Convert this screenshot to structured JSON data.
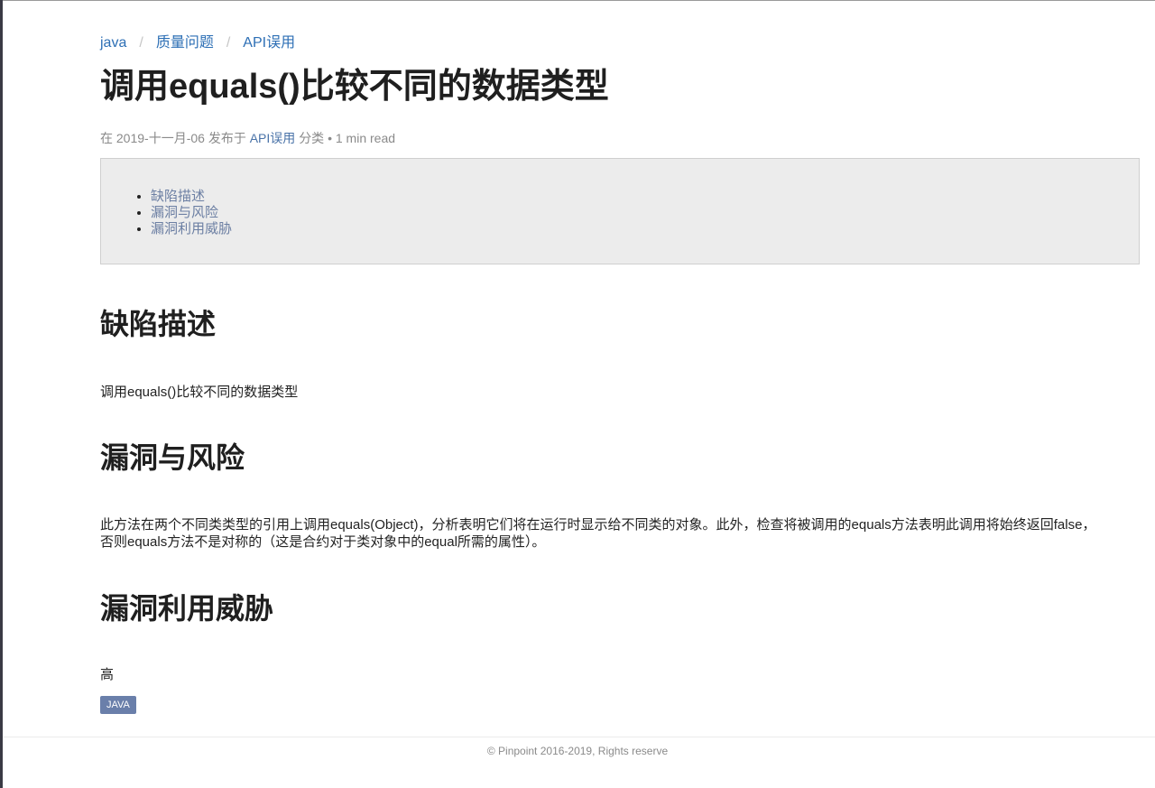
{
  "breadcrumb": {
    "items": [
      "java",
      "质量问题",
      "API误用"
    ],
    "separator": "/"
  },
  "title": "调用equals()比较不同的数据类型",
  "meta": {
    "prefix": "在",
    "date": "2019-十一月-06",
    "published_in": "发布于",
    "category": "API误用",
    "category_suffix": "分类",
    "dot": "•",
    "read_time": "1 min read"
  },
  "toc": {
    "items": [
      "缺陷描述",
      "漏洞与风险",
      "漏洞利用威胁"
    ]
  },
  "sections": [
    {
      "heading": "缺陷描述",
      "body": "调用equals()比较不同的数据类型"
    },
    {
      "heading": "漏洞与风险",
      "body": "此方法在两个不同类类型的引用上调用equals(Object)，分析表明它们将在运行时显示给不同类的对象。此外，检查将被调用的equals方法表明此调用将始终返回false，否则equals方法不是对称的（这是合约对于类对象中的equal所需的属性）。"
    },
    {
      "heading": "漏洞利用威胁",
      "body": "高"
    }
  ],
  "tag": "JAVA",
  "footer": "© Pinpoint 2016-2019, Rights reserve",
  "colors": {
    "link": "#2d6fb5",
    "toc_link": "#6c7fa3",
    "tag_bg": "#6a7faa",
    "toc_bg": "#ececec"
  }
}
